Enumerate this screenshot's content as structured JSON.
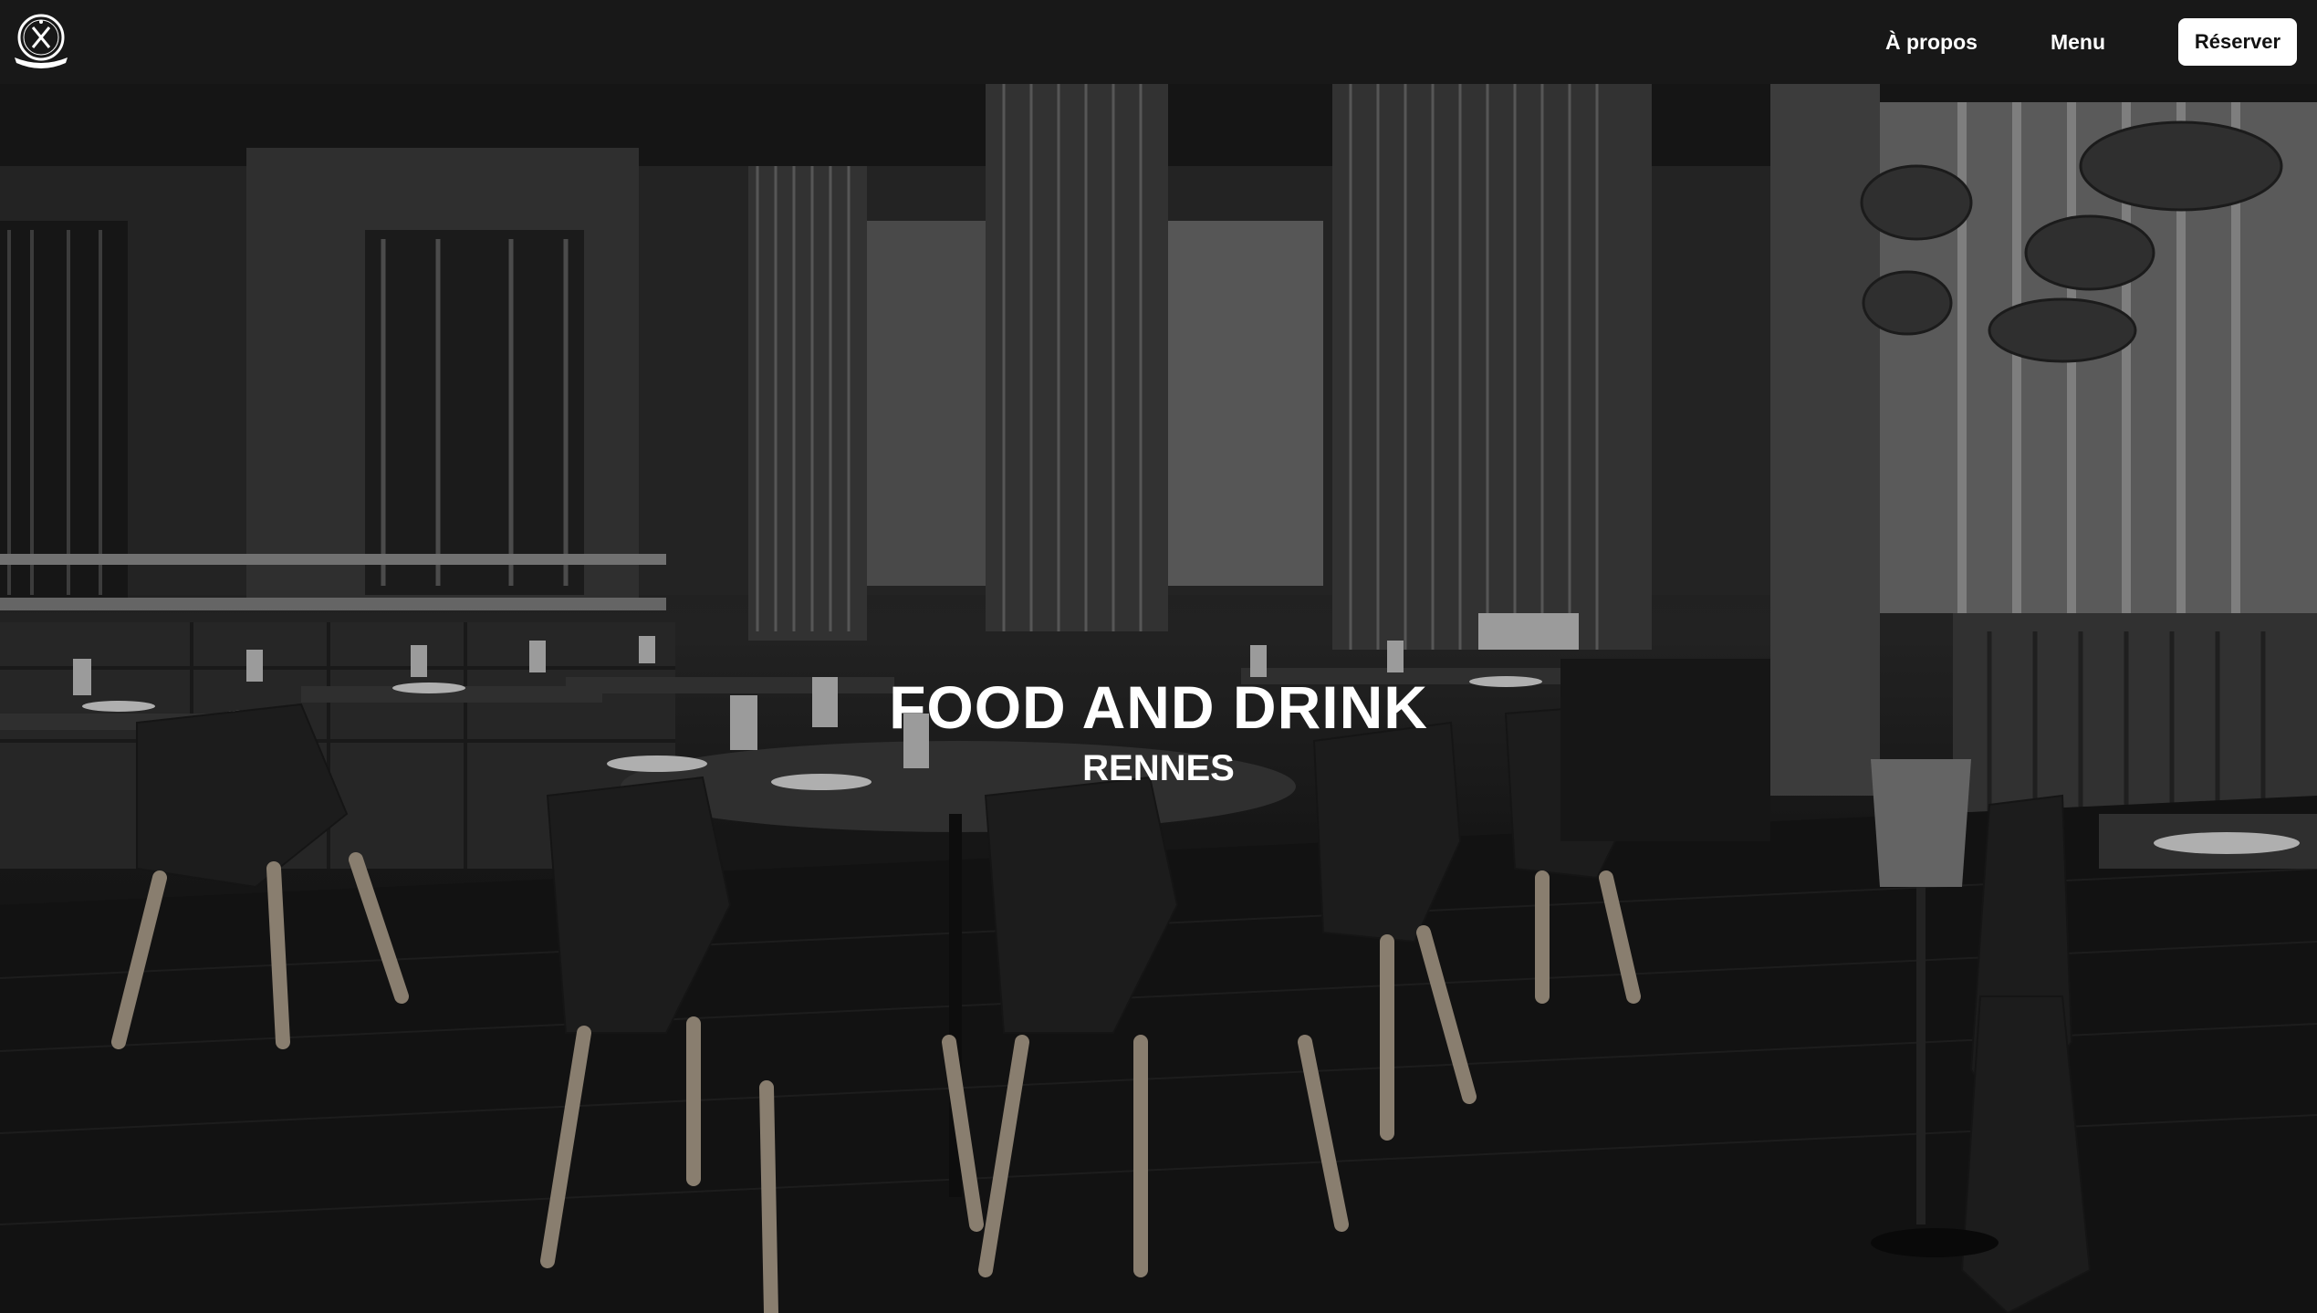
{
  "nav": {
    "logo_icon": "restaurant-logo-icon",
    "logo_text": "FOOD AND DRINK",
    "links": [
      "À propos",
      "Menu"
    ],
    "cta_label": "Réserver"
  },
  "hero": {
    "title": "FOOD AND DRINK",
    "subtitle": "RENNES",
    "background_image": "restaurant-dining-room"
  },
  "colors": {
    "navbar_bg": "#181818",
    "nav_text": "#ffffff",
    "cta_bg": "#ffffff",
    "cta_text": "#111111"
  }
}
